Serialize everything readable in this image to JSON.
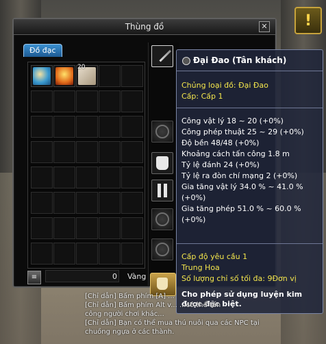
{
  "window": {
    "title": "Thùng đồ",
    "close_label": "✕",
    "tab_label": "Đồ đạc"
  },
  "inventory": {
    "items": [
      {
        "slot": 0,
        "icon": "ice-armor-icon"
      },
      {
        "slot": 1,
        "icon": "fire-helmet-icon"
      },
      {
        "slot": 2,
        "icon": "scroll-stack-icon",
        "stack": "20"
      }
    ],
    "money_value": "0",
    "money_unit": "Vàng"
  },
  "equipment": {
    "slots": [
      {
        "name": "weapon-slot",
        "icon": "sword-icon"
      },
      {
        "name": "ring-slot-1",
        "icon": "ring-icon"
      },
      {
        "name": "armor-slot",
        "icon": "armor-icon"
      },
      {
        "name": "pants-slot",
        "icon": "pants-icon"
      },
      {
        "name": "bracelet-slot",
        "icon": "bracelet-icon"
      },
      {
        "name": "ring-slot-2",
        "icon": "ring-icon"
      },
      {
        "name": "costume-slot",
        "icon": "costume-icon"
      }
    ]
  },
  "tooltip": {
    "title": "Đại Đao (Tân khách)",
    "type_line": "Chủng loại đồ: Đại Đao",
    "level_line": "Cấp: Cấp 1",
    "stats": [
      "Công vật lý 18 ~ 20 (+0%)",
      "Công phép thuật 25 ~ 29 (+0%)",
      "Độ bền 48/48 (+0%)",
      "Khoảng cách tấn công 1.8 m",
      "Tỷ lệ đánh 24 (+0%)",
      "Tỷ lệ ra đòn chí mạng 2 (+0%)",
      "Gia tăng vật lý 34.0 % ~ 41.0 %",
      "(+0%)",
      "Gia tăng phép 51.0 % ~ 60.0 %",
      "(+0%)"
    ],
    "requirements": [
      "Cấp độ yêu cầu 1",
      "Trung Hoa",
      "Số lượng chỉ số tối đa: 9Đơn vị"
    ],
    "note_line1": "Cho phép sử dụng luyện kim",
    "note_line2": "được đặc biệt."
  },
  "chat": {
    "lines": [
      "[Chỉ dẫn] Bấm phím [A] ...",
      "[Chỉ dẫn] Bấm phím Alt v... ...có thể tấn",
      "công người chơi khác...",
      "[Chỉ dẫn] Bạn có thể mua thú nuôi qua các NPC tại",
      "chuồng ngựa ở các thành."
    ]
  },
  "colors": {
    "tab_blue": "#2a78c0",
    "tooltip_bg": "#20263a",
    "stat_yellow": "#f4e64c"
  }
}
